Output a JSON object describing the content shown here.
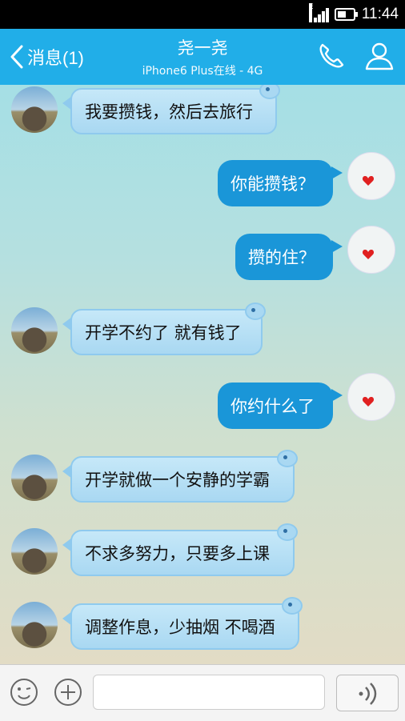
{
  "status_bar": {
    "network": "E",
    "time": "11:44"
  },
  "header": {
    "back_label": "消息(1)",
    "title": "尧一尧",
    "subtitle": "iPhone6 Plus在线 - 4G"
  },
  "messages": [
    {
      "sender": "other",
      "text": "我要攒钱，然后去旅行"
    },
    {
      "sender": "self",
      "text": "你能攒钱？"
    },
    {
      "sender": "self",
      "text": "攒的住？"
    },
    {
      "sender": "other",
      "text": "开学不约了 就有钱了"
    },
    {
      "sender": "self",
      "text": "你约什么了"
    },
    {
      "sender": "other",
      "text": "开学就做一个安静的学霸"
    },
    {
      "sender": "other",
      "text": "不求多努力，只要多上课"
    },
    {
      "sender": "other",
      "text": "调整作息，少抽烟 不喝酒"
    }
  ],
  "input": {
    "value": "",
    "placeholder": ""
  },
  "colors": {
    "header": "#21aee8",
    "self_bubble": "#1a96d8",
    "other_bubble": "#b8e0f5"
  }
}
